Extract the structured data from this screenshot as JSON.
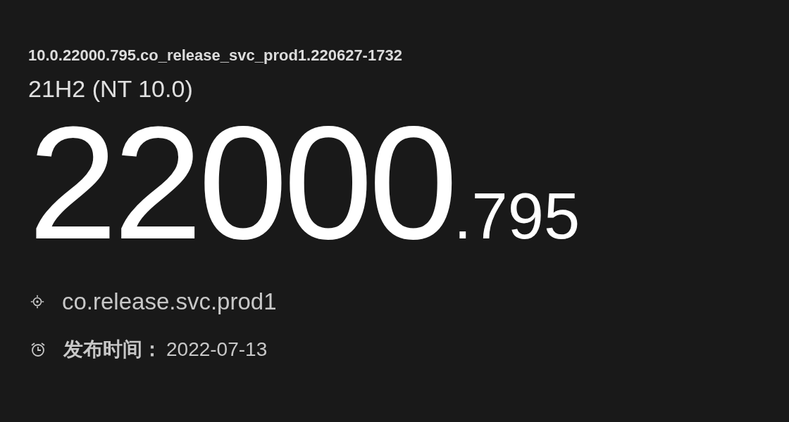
{
  "full_build": "10.0.22000.795.co_release_svc_prod1.220627-1732",
  "version": "21H2 (NT 10.0)",
  "build": {
    "major": "22000",
    "minor": ".795"
  },
  "details": [
    {
      "kind": "branch",
      "value": "co.release.svc.prod1"
    },
    {
      "kind": "date",
      "label": "发布时间：",
      "value": "2022-07-13"
    }
  ]
}
